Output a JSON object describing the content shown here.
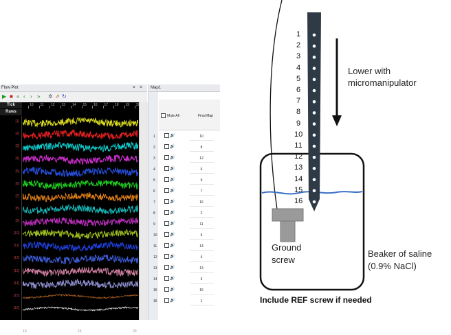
{
  "flow_plot": {
    "title": "Flow Plot",
    "tick_label": "Tick",
    "raws_label": "Raws",
    "ticks": [
      "10",
      "11",
      "12",
      "13",
      "14",
      "15",
      "16",
      "17",
      "18",
      "19",
      "20"
    ],
    "channels": [
      "[1]",
      "[2]",
      "[3]",
      "[4]",
      "[5]",
      "[6]",
      "[7]",
      "[8]",
      "[9]",
      "[10]",
      "[11]",
      "[12]",
      "[13]",
      "[14]",
      "[15]",
      "[16]"
    ],
    "trace_colors": [
      "#d8d820",
      "#e02020",
      "#10c8c8",
      "#d030d0",
      "#2850e0",
      "#20d020",
      "#e08018",
      "#18b8b8",
      "#c030c0",
      "#a0c020",
      "#2040e0",
      "#4060e0",
      "#d080a0",
      "#9090d0",
      "#b06020",
      "#e0e0e0"
    ],
    "x_ticks": [
      "10",
      "15",
      "20"
    ]
  },
  "map": {
    "title": "Map1",
    "mute_all": "Mute All",
    "final_map_header": "Final Map",
    "rows": [
      {
        "n": "1",
        "v": "10"
      },
      {
        "n": "2",
        "v": "8"
      },
      {
        "n": "3",
        "v": "12"
      },
      {
        "n": "4",
        "v": "6"
      },
      {
        "n": "5",
        "v": "9"
      },
      {
        "n": "6",
        "v": "7"
      },
      {
        "n": "7",
        "v": "16"
      },
      {
        "n": "8",
        "v": "2"
      },
      {
        "n": "9",
        "v": "11"
      },
      {
        "n": "10",
        "v": "5"
      },
      {
        "n": "11",
        "v": "14"
      },
      {
        "n": "12",
        "v": "4"
      },
      {
        "n": "13",
        "v": "13"
      },
      {
        "n": "14",
        "v": "3"
      },
      {
        "n": "15",
        "v": "15"
      },
      {
        "n": "16",
        "v": "1"
      }
    ]
  },
  "diagram": {
    "electrode_numbers": [
      "1",
      "2",
      "3",
      "4",
      "5",
      "6",
      "7",
      "8",
      "9",
      "10",
      "11",
      "12",
      "13",
      "14",
      "15",
      "16"
    ],
    "lower_label_line1": "Lower with",
    "lower_label_line2": "micromanipulator",
    "ground_line1": "Ground",
    "ground_line2": "screw",
    "beaker_line1": "Beaker of saline",
    "beaker_line2": "(0.9% NaCl)",
    "caption": "Include REF screw if needed"
  }
}
